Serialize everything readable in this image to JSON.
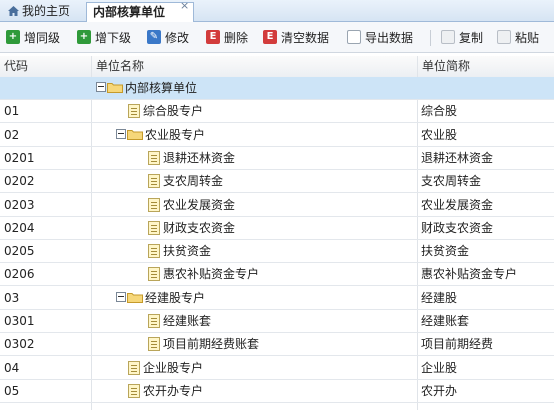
{
  "tabs": [
    {
      "label": "我的主页",
      "icon": "home-icon"
    },
    {
      "label": "内部核算单位",
      "close_glyph": "×"
    }
  ],
  "toolbar": [
    {
      "label": "增同级",
      "icon": "add-sibling-icon"
    },
    {
      "label": "增下级",
      "icon": "add-child-icon"
    },
    {
      "label": "修改",
      "icon": "edit-icon"
    },
    {
      "label": "删除",
      "icon": "delete-icon"
    },
    {
      "label": "清空数据",
      "icon": "clear-data-icon"
    },
    {
      "label": "导出数据",
      "icon": "export-icon"
    },
    {
      "label": "复制",
      "icon": "copy-icon"
    },
    {
      "label": "粘贴",
      "icon": "paste-icon"
    }
  ],
  "grid": {
    "columns": [
      "代码",
      "单位名称",
      "单位简称"
    ],
    "rows": [
      {
        "code": "",
        "name": "内部核算单位",
        "short": "",
        "level": 0,
        "type": "folder",
        "selected": true
      },
      {
        "code": "01",
        "name": "综合股专户",
        "short": "综合股",
        "level": 1,
        "type": "leaf"
      },
      {
        "code": "02",
        "name": "农业股专户",
        "short": "农业股",
        "level": 1,
        "type": "folder"
      },
      {
        "code": "0201",
        "name": "退耕还林资金",
        "short": "退耕还林资金",
        "level": 2,
        "type": "leaf"
      },
      {
        "code": "0202",
        "name": "支农周转金",
        "short": "支农周转金",
        "level": 2,
        "type": "leaf"
      },
      {
        "code": "0203",
        "name": "农业发展资金",
        "short": "农业发展资金",
        "level": 2,
        "type": "leaf"
      },
      {
        "code": "0204",
        "name": "财政支农资金",
        "short": "财政支农资金",
        "level": 2,
        "type": "leaf"
      },
      {
        "code": "0205",
        "name": "扶贫资金",
        "short": "扶贫资金",
        "level": 2,
        "type": "leaf"
      },
      {
        "code": "0206",
        "name": "惠农补贴资金专户",
        "short": "惠农补贴资金专户",
        "level": 2,
        "type": "leaf"
      },
      {
        "code": "03",
        "name": "经建股专户",
        "short": "经建股",
        "level": 1,
        "type": "folder"
      },
      {
        "code": "0301",
        "name": "经建账套",
        "short": "经建账套",
        "level": 2,
        "type": "leaf"
      },
      {
        "code": "0302",
        "name": "项目前期经费账套",
        "short": "项目前期经费",
        "level": 2,
        "type": "leaf"
      },
      {
        "code": "04",
        "name": "企业股专户",
        "short": "企业股",
        "level": 1,
        "type": "leaf"
      },
      {
        "code": "05",
        "name": "农开办专户",
        "short": "农开办",
        "level": 1,
        "type": "leaf"
      }
    ]
  }
}
